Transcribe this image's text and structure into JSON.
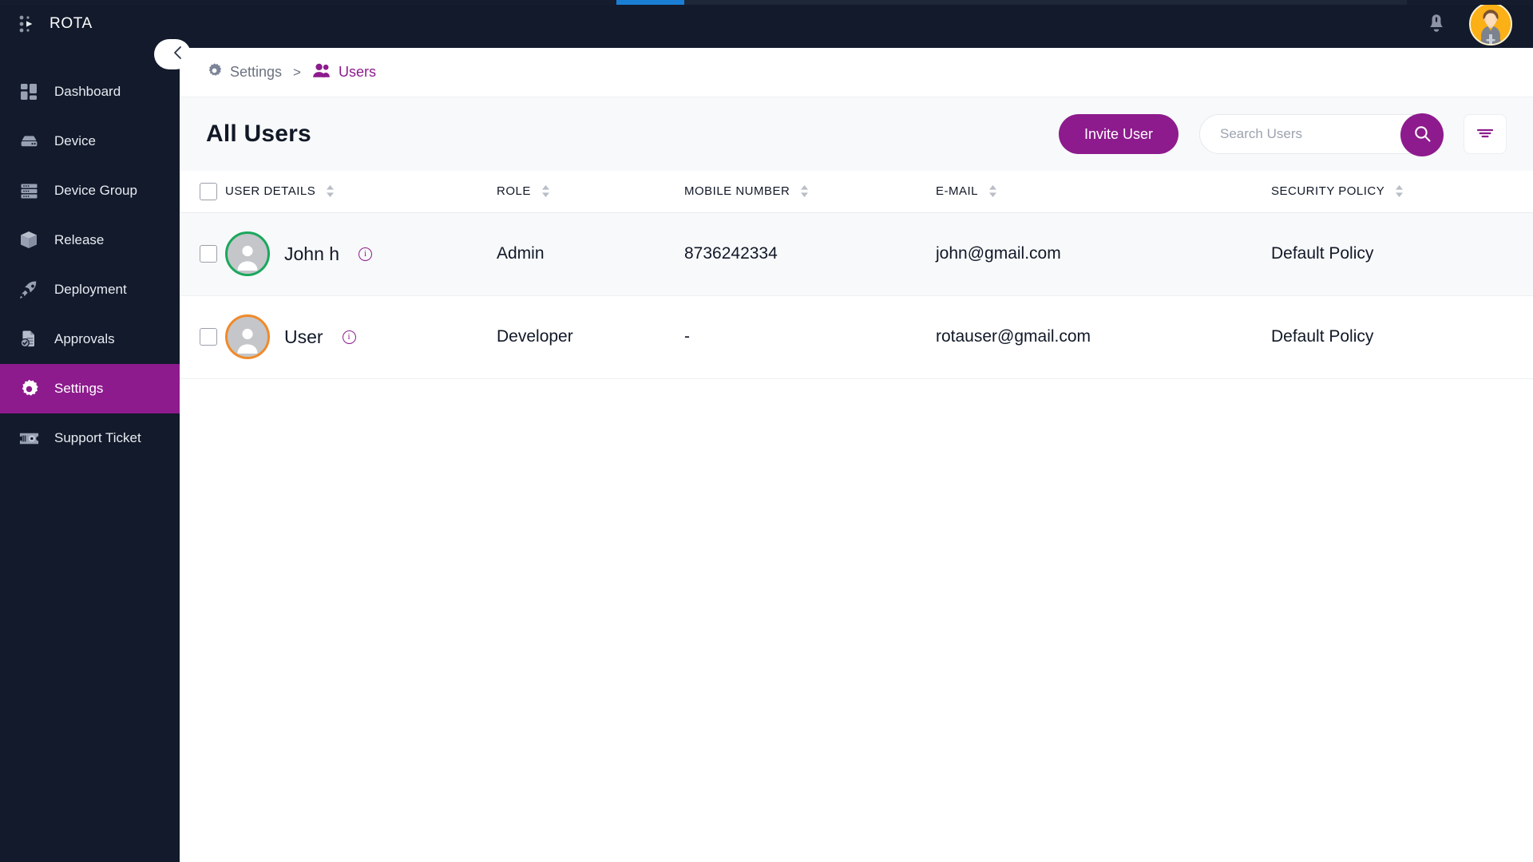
{
  "app": {
    "brand": "ROTA",
    "brand_icon": "dots-play-logo",
    "accent": "#8d1b8d",
    "sidebar_bg": "#121a2b"
  },
  "topbar": {
    "notification_icon": "bell-icon",
    "avatar_icon": "user-avatar",
    "progress_color": "#1a7fd4"
  },
  "sidebar": {
    "items": [
      {
        "label": "Dashboard",
        "icon": "dashboard-grid-icon",
        "active": false
      },
      {
        "label": "Device",
        "icon": "device-icon",
        "active": false
      },
      {
        "label": "Device Group",
        "icon": "device-group-icon",
        "active": false
      },
      {
        "label": "Release",
        "icon": "box-icon",
        "active": false
      },
      {
        "label": "Deployment",
        "icon": "rocket-icon",
        "active": false
      },
      {
        "label": "Approvals",
        "icon": "document-check-icon",
        "active": false
      },
      {
        "label": "Settings",
        "icon": "gear-icon",
        "active": true
      },
      {
        "label": "Support Ticket",
        "icon": "ticket-icon",
        "active": false
      }
    ]
  },
  "breadcrumb": {
    "collapse_icon": "chevron-left-icon",
    "items": [
      {
        "label": "Settings",
        "icon": "gear-icon",
        "current": false
      },
      {
        "label": "Users",
        "icon": "users-icon",
        "current": true
      }
    ],
    "separator": ">"
  },
  "panel": {
    "title": "All Users",
    "invite_label": "Invite User",
    "search_placeholder": "Search Users",
    "search_value": "",
    "search_icon": "search-icon",
    "filter_icon": "filter-icon"
  },
  "table": {
    "select_all_checked": false,
    "columns": [
      {
        "label": "USER DETAILS",
        "sortable": true
      },
      {
        "label": "ROLE",
        "sortable": true
      },
      {
        "label": "MOBILE NUMBER",
        "sortable": true
      },
      {
        "label": "E-MAIL",
        "sortable": true
      },
      {
        "label": "SECURITY POLICY",
        "sortable": true
      }
    ],
    "rows": [
      {
        "checked": false,
        "name": "John h",
        "avatar_ring": "#1aa85c",
        "role": "Admin",
        "mobile": "8736242334",
        "email": "john@gmail.com",
        "policy": "Default Policy"
      },
      {
        "checked": false,
        "name": "User",
        "avatar_ring": "#f08a2a",
        "role": "Developer",
        "mobile": "-",
        "email": "rotauser@gmail.com",
        "policy": "Default Policy"
      }
    ]
  }
}
